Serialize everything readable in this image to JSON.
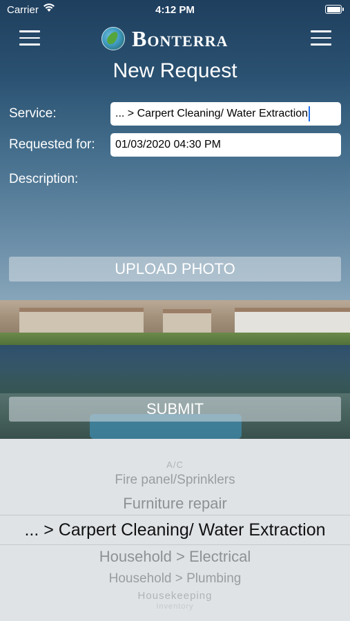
{
  "status_bar": {
    "carrier": "Carrier",
    "time": "4:12 PM"
  },
  "header": {
    "brand": "Bonterra",
    "title": "New Request"
  },
  "form": {
    "service_label": "Service:",
    "service_value": "... > Carpert Cleaning/ Water Extraction",
    "requested_for_label": "Requested for:",
    "requested_for_value": "01/03/2020 04:30 PM",
    "description_label": "Description:",
    "upload_label": "UPLOAD PHOTO",
    "submit_label": "SUBMIT"
  },
  "picker": {
    "items": [
      "A/C",
      "Fire panel/Sprinklers",
      "Furniture repair",
      "... > Carpert Cleaning/ Water Extraction",
      "Household > Electrical",
      "Household > Plumbing",
      "Housekeeping",
      "Inventory"
    ],
    "selected_index": 3
  }
}
